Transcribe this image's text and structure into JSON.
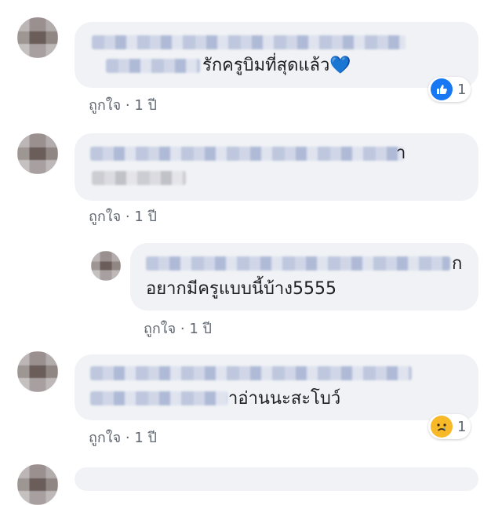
{
  "comments": [
    {
      "text": "รักครูบิมที่สุดแล้ว💙",
      "like_label": "ถูกใจ",
      "separator": "·",
      "time": "1 ปี",
      "reaction_count": "1"
    },
    {
      "text_tail": "า",
      "like_label": "ถูกใจ",
      "separator": "·",
      "time": "1 ปี"
    },
    {
      "text_tail": "ก",
      "text": "อยากมีครูแบบนี้บ้าง5555",
      "like_label": "ถูกใจ",
      "separator": "·",
      "time": "1 ปี"
    },
    {
      "text": "าอ่านนะสะโบว์",
      "like_label": "ถูกใจ",
      "separator": "·",
      "time": "1 ปี",
      "reaction_count": "1"
    }
  ],
  "colors": {
    "bubble": "#f0f2f5",
    "meta_text": "#606770",
    "like_blue": "#1877f2",
    "sad_yellow": "#f7b928"
  },
  "icons": {
    "like_reaction": "thumbs-up-icon",
    "sad_reaction": "sad-face-icon"
  }
}
